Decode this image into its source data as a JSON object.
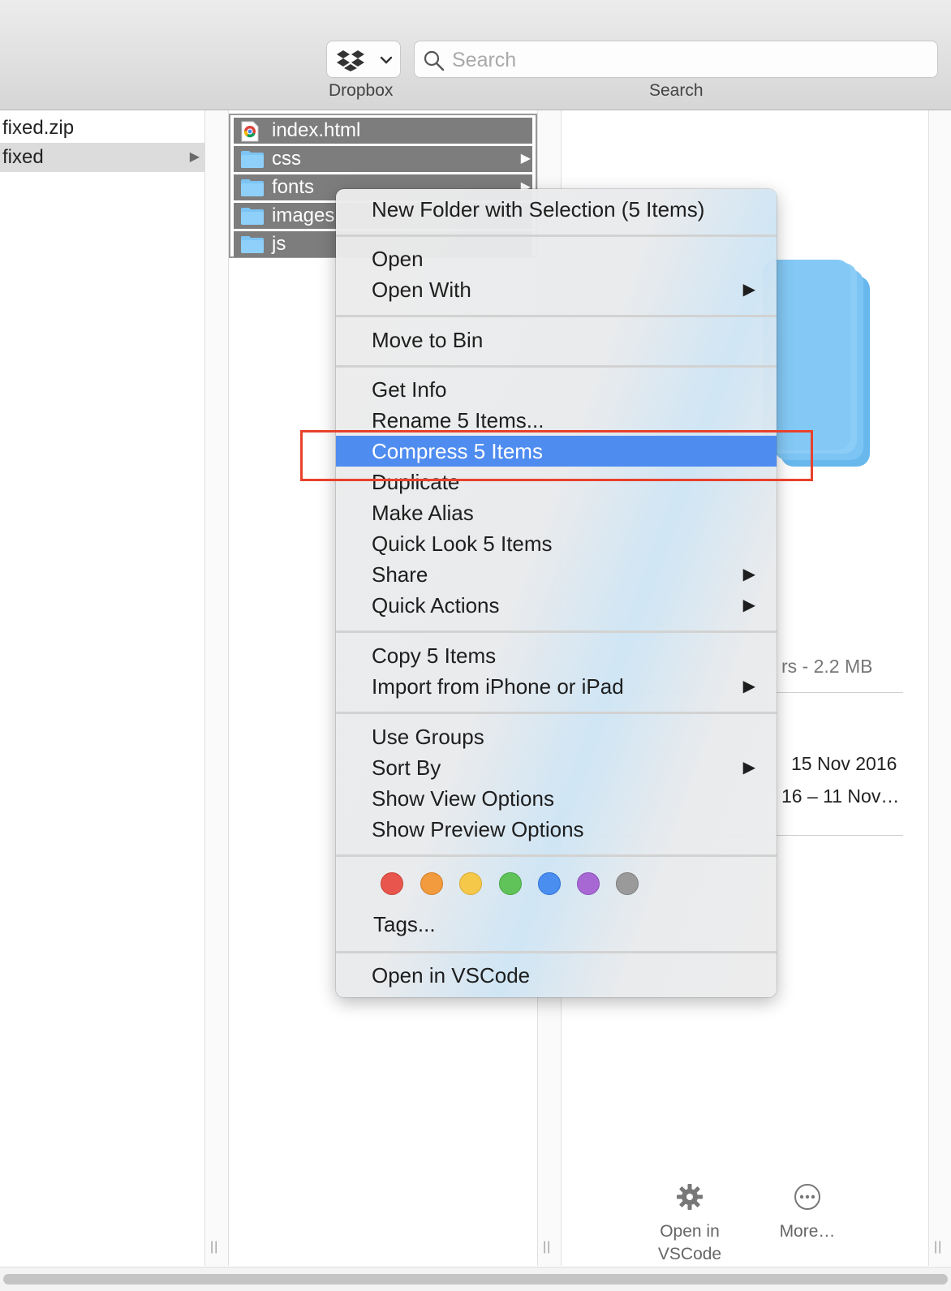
{
  "toolbar": {
    "dropbox_label": "Dropbox",
    "search_label": "Search",
    "search_placeholder": "Search"
  },
  "column1": {
    "items": [
      {
        "label": "fixed.zip",
        "selected": false
      },
      {
        "label": "fixed",
        "selected": true
      }
    ]
  },
  "column2": {
    "items": [
      {
        "label": "index.html",
        "icon": "chrome-html-icon"
      },
      {
        "label": "css",
        "icon": "folder-icon"
      },
      {
        "label": "fonts",
        "icon": "folder-icon"
      },
      {
        "label": "images",
        "icon": "folder-icon"
      },
      {
        "label": "js",
        "icon": "folder-icon"
      }
    ]
  },
  "preview": {
    "size_text": "rs - 2.2 MB",
    "created_text": "15 Nov 2016",
    "range_text": "16 – 11 Nov…",
    "actions": [
      {
        "label": "Open in VSCode",
        "icon": "gear-icon"
      },
      {
        "label": "More…",
        "icon": "ellipsis-circle-icon"
      }
    ]
  },
  "context_menu": {
    "new_folder": "New Folder with Selection (5 Items)",
    "open": "Open",
    "open_with": "Open With",
    "move_to_bin": "Move to Bin",
    "get_info": "Get Info",
    "rename": "Rename 5 Items...",
    "compress": "Compress 5 Items",
    "duplicate": "Duplicate",
    "make_alias": "Make Alias",
    "quick_look": "Quick Look 5 Items",
    "share": "Share",
    "quick_actions": "Quick Actions",
    "copy": "Copy 5 Items",
    "import": "Import from iPhone or iPad",
    "use_groups": "Use Groups",
    "sort_by": "Sort By",
    "show_view_options": "Show View Options",
    "show_preview_options": "Show Preview Options",
    "tags": "Tags...",
    "open_in_vscode": "Open in VSCode",
    "highlighted_item": "Compress 5 Items",
    "tag_colors": [
      "#e8554c",
      "#f19a3e",
      "#f5c84a",
      "#60c35a",
      "#4a8ef0",
      "#a868d4",
      "#9a9a9a"
    ]
  }
}
